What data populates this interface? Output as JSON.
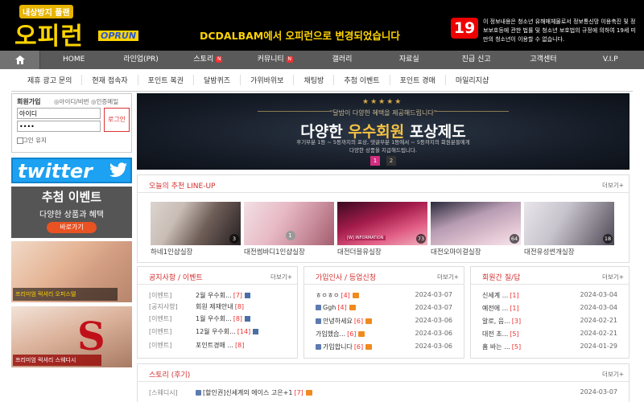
{
  "header": {
    "logo_tag": "내상방지 플랜",
    "logo_main": "오피런",
    "logo_eng": "OPRUN",
    "notice": "DCDALBAM에서 오피런으로 변경되었습니다",
    "age_badge": "19",
    "age_text": "이 정보내용은 청소년 유해매체물로서 정보통신망 이용촉진 및 정보보호등에 관한 법률 및 청소년 보호법의 규정에 의하여 19세 미만의 청소년이 이용할 수 없습니다."
  },
  "mainnav": {
    "items": [
      {
        "label": "HOME"
      },
      {
        "label": "라인업(PR)"
      },
      {
        "label": "스토리",
        "new": "N"
      },
      {
        "label": "커뮤니티",
        "new": "N"
      },
      {
        "label": "갤러리"
      },
      {
        "label": "자료실"
      },
      {
        "label": "진급 신고"
      },
      {
        "label": "고객센터"
      },
      {
        "label": "V.I.P"
      }
    ]
  },
  "subnav": {
    "items": [
      "제휴 광고 문의",
      "현재 접속자",
      "포인트 복권",
      "달밤퀴즈",
      "가위바위보",
      "채팅방",
      "추첨 이벤트",
      "포인트 경매",
      "마일리지샵"
    ]
  },
  "login": {
    "title": "회원가입",
    "links": "◎아이디/비번 ◎인증메일",
    "id_value": "아이디",
    "pw_value": "••••",
    "button": "로그인",
    "keep": "로그인 유지"
  },
  "left_banners": {
    "twitter": "twitter",
    "lotto_title": "추첨 이벤트",
    "lotto_sub": "다양한 상품과 혜택",
    "lotto_btn": "바로가기",
    "ad1_caption": "프리미엄 럭셔리 오피스텔",
    "ad2_letter": "S",
    "ad2_caption": "프리미엄 럭셔리 스웨디시"
  },
  "banner": {
    "stars": "★★★★★",
    "sub": "\"달밤이 다양한 혜택을 제공해드립니다\"",
    "main_pre": "다양한 ",
    "main_hl": "우수회원",
    "main_post": " 포상제도",
    "desc1": "후기부분 1등 ~ 5등까지의 포상, 댓글부분 1등에서 ~ 5등까지의 회원분들에게",
    "desc2": "다양한 상품을 지급해드립니다.",
    "page1": "1",
    "page2": "2"
  },
  "recommend": {
    "title": "오늘의 추천 LINE-UP",
    "more": "더보기+",
    "items": [
      {
        "caption": "하네1인샵실장",
        "count": "3"
      },
      {
        "caption": "대전썸바디1인샵실장",
        "count": "1"
      },
      {
        "caption": "대전더블유실장",
        "count": "73",
        "label": "[W] INFORMATION"
      },
      {
        "caption": "대전오마이걸실장",
        "count": "64"
      },
      {
        "caption": "대전유성썬개실장",
        "count": "18"
      }
    ]
  },
  "notice_box": {
    "title": "공지사항 / 이벤트",
    "more": "더보기+",
    "rows": [
      {
        "cat": "[이벤트]",
        "title": "2월 우수회...",
        "cmt": "[7]"
      },
      {
        "cat": "[공지사항]",
        "title": "회원 제재안내",
        "cmt": "[8]"
      },
      {
        "cat": "[이벤트]",
        "title": "1월 우수회...",
        "cmt": "[8]"
      },
      {
        "cat": "[이벤트]",
        "title": "12월 우수회...",
        "cmt": "[14]"
      },
      {
        "cat": "[이벤트]",
        "title": "포인트경매 ...",
        "cmt": "[8]"
      }
    ]
  },
  "greet_box": {
    "title": "가입인사 / 등업신청",
    "more": "더보기+",
    "rows": [
      {
        "title": "ㅎㅇㅎㅇ",
        "cmt": "[4]",
        "date": "2024-03-07"
      },
      {
        "title": "Ggh",
        "cmt": "[4]",
        "date": "2024-03-07"
      },
      {
        "title": "안녕하세요",
        "cmt": "[6]",
        "date": "2024-03-06"
      },
      {
        "title": "가입했습...",
        "cmt": "[6]",
        "date": "2024-03-06"
      },
      {
        "title": "가입합니다",
        "cmt": "[6]",
        "date": "2024-03-06"
      }
    ]
  },
  "qna_box": {
    "title": "회원간 질/답",
    "more": "더보기+",
    "rows": [
      {
        "title": "신세계 ...",
        "cmt": "[1]",
        "date": "2024-03-04"
      },
      {
        "title": "예전에 ...",
        "cmt": "[1]",
        "date": "2024-03-04"
      },
      {
        "title": "알로, 음...",
        "cmt": "[3]",
        "date": "2024-02-21"
      },
      {
        "title": "대전 초...",
        "cmt": "[5]",
        "date": "2024-02-21"
      },
      {
        "title": "홈 바는 ...",
        "cmt": "[5]",
        "date": "2024-01-29"
      }
    ]
  },
  "story_box": {
    "title": "스토리 (후기)",
    "more": "더보기+",
    "rows": [
      {
        "cat": "[스웨디시]",
        "title": "[할인권]신세계의 에이스 고은+1",
        "cmt": "[7]",
        "date": "2024-03-07"
      }
    ]
  },
  "colors": {
    "accent": "#d32d2d",
    "nav": "#5a5a5a",
    "logo": "#ffd400",
    "twitter": "#1da1f2"
  }
}
